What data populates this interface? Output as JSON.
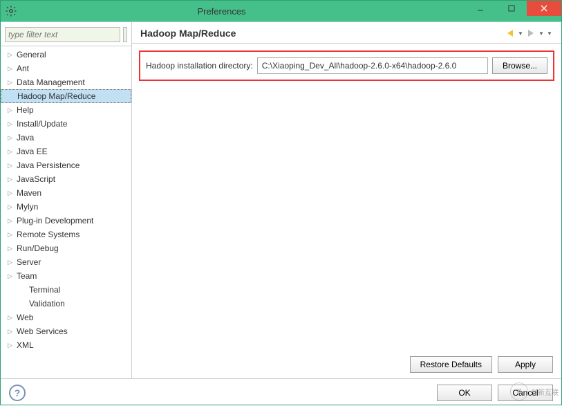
{
  "window": {
    "title": "Preferences"
  },
  "sidebar": {
    "filter_placeholder": "type filter text",
    "items": [
      {
        "label": "General",
        "expandable": true
      },
      {
        "label": "Ant",
        "expandable": true
      },
      {
        "label": "Data Management",
        "expandable": true
      },
      {
        "label": "Hadoop Map/Reduce",
        "expandable": false,
        "selected": true
      },
      {
        "label": "Help",
        "expandable": true
      },
      {
        "label": "Install/Update",
        "expandable": true
      },
      {
        "label": "Java",
        "expandable": true
      },
      {
        "label": "Java EE",
        "expandable": true
      },
      {
        "label": "Java Persistence",
        "expandable": true
      },
      {
        "label": "JavaScript",
        "expandable": true
      },
      {
        "label": "Maven",
        "expandable": true
      },
      {
        "label": "Mylyn",
        "expandable": true
      },
      {
        "label": "Plug-in Development",
        "expandable": true
      },
      {
        "label": "Remote Systems",
        "expandable": true
      },
      {
        "label": "Run/Debug",
        "expandable": true
      },
      {
        "label": "Server",
        "expandable": true
      },
      {
        "label": "Team",
        "expandable": true
      },
      {
        "label": "Terminal",
        "expandable": false,
        "child": true
      },
      {
        "label": "Validation",
        "expandable": false,
        "child": true
      },
      {
        "label": "Web",
        "expandable": true
      },
      {
        "label": "Web Services",
        "expandable": true
      },
      {
        "label": "XML",
        "expandable": true
      }
    ]
  },
  "main": {
    "heading": "Hadoop Map/Reduce",
    "field_label": "Hadoop installation directory:",
    "field_value": "C:\\Xiaoping_Dev_All\\hadoop-2.6.0-x64\\hadoop-2.6.0",
    "browse_label": "Browse...",
    "restore_label": "Restore Defaults",
    "apply_label": "Apply"
  },
  "footer": {
    "ok_label": "OK",
    "cancel_label": "Cancel"
  },
  "colors": {
    "accent": "#46c08b",
    "highlight_border": "#e33",
    "selection": "#c2e0f4"
  }
}
